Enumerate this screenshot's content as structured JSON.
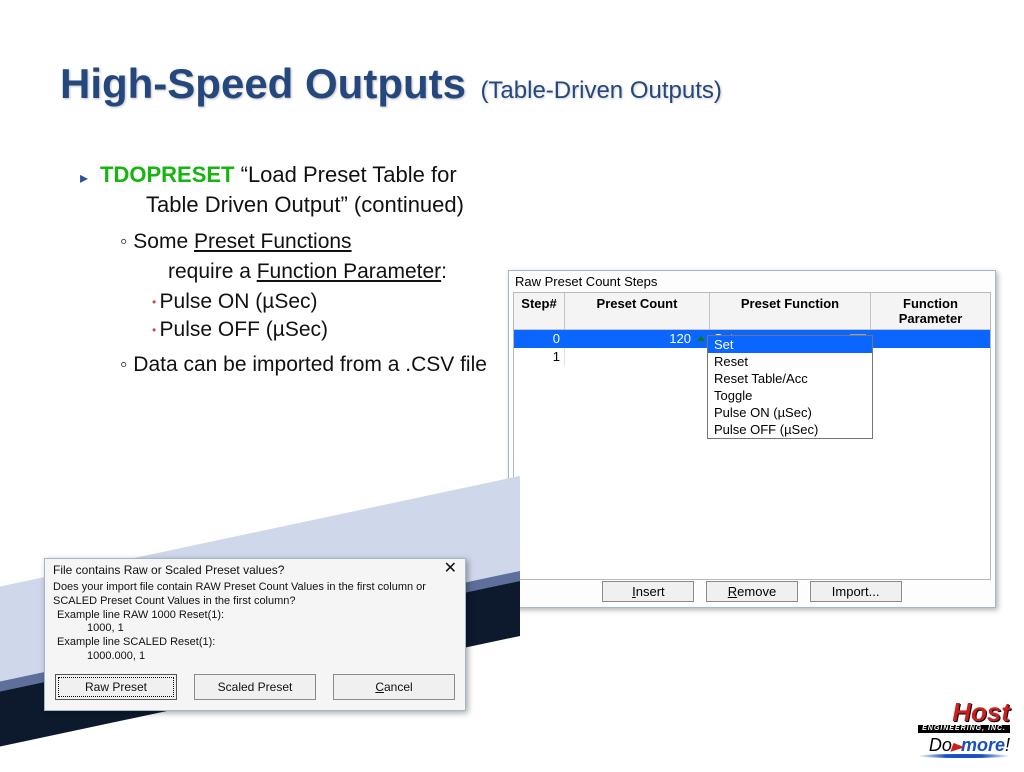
{
  "title": {
    "main": "High-Speed Outputs",
    "sub": "(Table-Driven Outputs)"
  },
  "bullet": {
    "keyword": "TDOPRESET",
    "text": " “Load Preset Table for Table Driven Output” (continued)",
    "sub1a": "Some ",
    "sub1b": "Preset Functions",
    "sub1c": " require a ",
    "sub1d": "Function Parameter",
    "sub1e": ":",
    "item1": "Pulse ON (µSec)",
    "item2": "Pulse OFF (µSec)",
    "sub2": "Data can be imported from a .CSV file"
  },
  "raw": {
    "title": "Raw Preset Count Steps",
    "headers": {
      "step": "Step#",
      "count": "Preset Count",
      "func": "Preset Function",
      "param": "Function Parameter"
    },
    "rows": [
      {
        "step": "0",
        "count": "120",
        "func": "Set",
        "param": ""
      },
      {
        "step": "1",
        "count": "",
        "func": "",
        "param": ""
      }
    ],
    "dropdown": [
      "Set",
      "Reset",
      "Reset Table/Acc",
      "Toggle",
      "Pulse ON (µSec)",
      "Pulse OFF (µSec)"
    ],
    "buttons": {
      "insert": "Insert",
      "remove": "Remove",
      "import": "Import..."
    }
  },
  "dialog": {
    "title": "File contains Raw or Scaled Preset values?",
    "l1": "Does your import file contain RAW Preset Count Values in the first column or",
    "l2": "SCALED Preset Count Values in the first column?",
    "l3": " Example line RAW 1000 Reset(1):",
    "l4": "1000, 1",
    "l5": " Example line SCALED Reset(1):",
    "l6": "1000.000, 1",
    "btn1": "Raw Preset",
    "btn2": "Scaled Preset",
    "btn3": "Cancel"
  },
  "logos": {
    "host": "Host",
    "eng": "ENGINEERING, INC.",
    "do": "Do",
    "more": "more"
  }
}
